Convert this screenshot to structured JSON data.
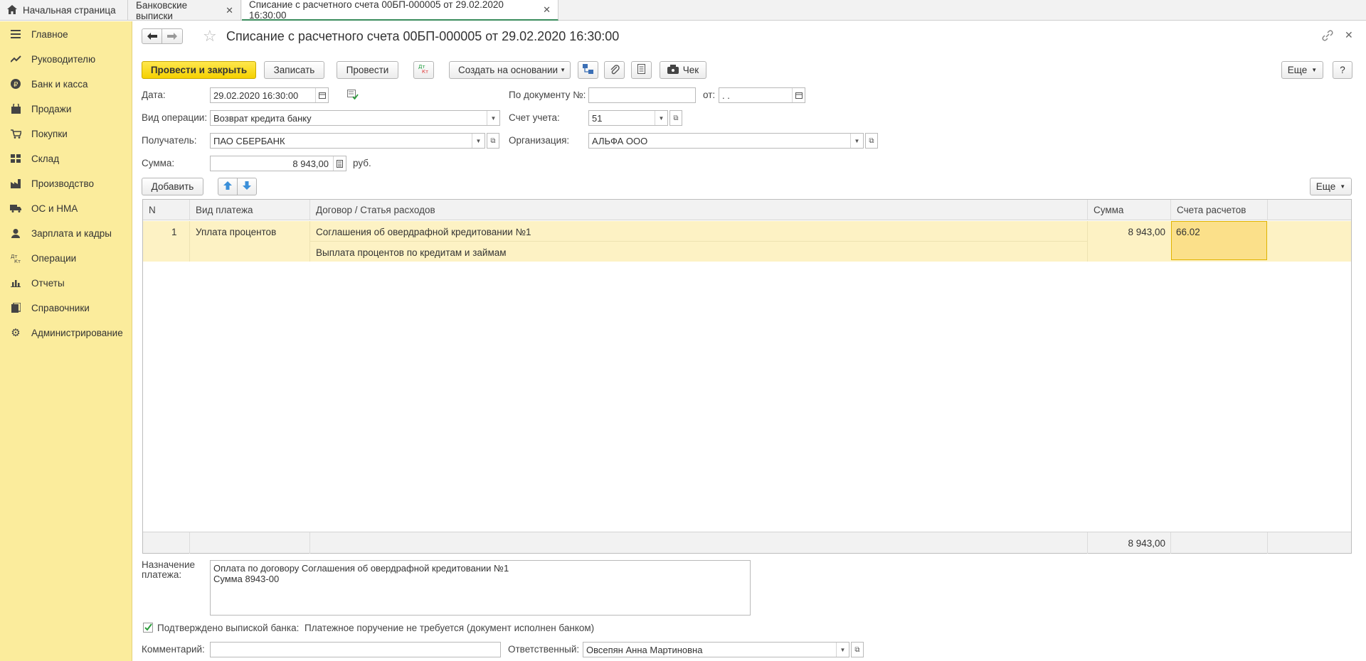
{
  "tabs": [
    {
      "label": "Начальная страница"
    },
    {
      "label": "Банковские выписки"
    },
    {
      "label": "Списание с расчетного счета 00БП-000005 от 29.02.2020 16:30:00"
    }
  ],
  "sidebar": {
    "items": [
      {
        "label": "Главное",
        "icon": "menu-icon"
      },
      {
        "label": "Руководителю",
        "icon": "trend-icon"
      },
      {
        "label": "Банк и касса",
        "icon": "ruble-icon"
      },
      {
        "label": "Продажи",
        "icon": "bag-icon"
      },
      {
        "label": "Покупки",
        "icon": "cart-icon"
      },
      {
        "label": "Склад",
        "icon": "grid-icon"
      },
      {
        "label": "Производство",
        "icon": "factory-icon"
      },
      {
        "label": "ОС и НМА",
        "icon": "truck-icon"
      },
      {
        "label": "Зарплата и кадры",
        "icon": "person-icon"
      },
      {
        "label": "Операции",
        "icon": "dtkt-icon"
      },
      {
        "label": "Отчеты",
        "icon": "bar-chart-icon"
      },
      {
        "label": "Справочники",
        "icon": "book-icon"
      },
      {
        "label": "Администрирование",
        "icon": "gear-icon"
      }
    ]
  },
  "document": {
    "title": "Списание с расчетного счета 00БП-000005 от 29.02.2020 16:30:00"
  },
  "toolbar": {
    "post_close": "Провести и закрыть",
    "save": "Записать",
    "post": "Провести",
    "dtkt": "Дт Кт",
    "create_based": "Создать на основании",
    "check": "Чек",
    "more": "Еще",
    "help": "?"
  },
  "form": {
    "date_label": "Дата:",
    "date_value": "29.02.2020 16:30:00",
    "op_label": "Вид операции:",
    "op_value": "Возврат кредита банку",
    "recipient_label": "Получатель:",
    "recipient_value": "ПАО СБЕРБАНК",
    "sum_label": "Сумма:",
    "sum_value": "8 943,00",
    "currency": "руб.",
    "docnum_label": "По документу №:",
    "docnum_value": "",
    "from_label": "от:",
    "from_value": " .  .",
    "account_label": "Счет учета:",
    "account_value": "51",
    "org_label": "Организация:",
    "org_value": "АЛЬФА ООО"
  },
  "table_toolbar": {
    "add": "Добавить",
    "more": "Еще"
  },
  "table": {
    "headers": [
      "N",
      "Вид платежа",
      "Договор / Статья расходов",
      "Сумма",
      "Счета расчетов"
    ],
    "rows": [
      {
        "n": "1",
        "type": "Уплата процентов",
        "contract": "Соглашения об овердрафной кредитовании №1",
        "expense": "Выплата процентов по кредитам и займам",
        "sum": "8 943,00",
        "accounts": "66.02"
      }
    ],
    "total": "8 943,00"
  },
  "purpose": {
    "label": "Назначение платежа:",
    "value": "Оплата по договору Соглашения об овердрафной кредитовании №1\nСумма 8943-00"
  },
  "confirm": {
    "label": "Подтверждено выпиской банка:",
    "note": "Платежное поручение не требуется (документ исполнен банком)"
  },
  "comment": {
    "label": "Комментарий:",
    "value": ""
  },
  "responsible": {
    "label": "Ответственный:",
    "value": "Овсепян Анна Мартиновна"
  }
}
